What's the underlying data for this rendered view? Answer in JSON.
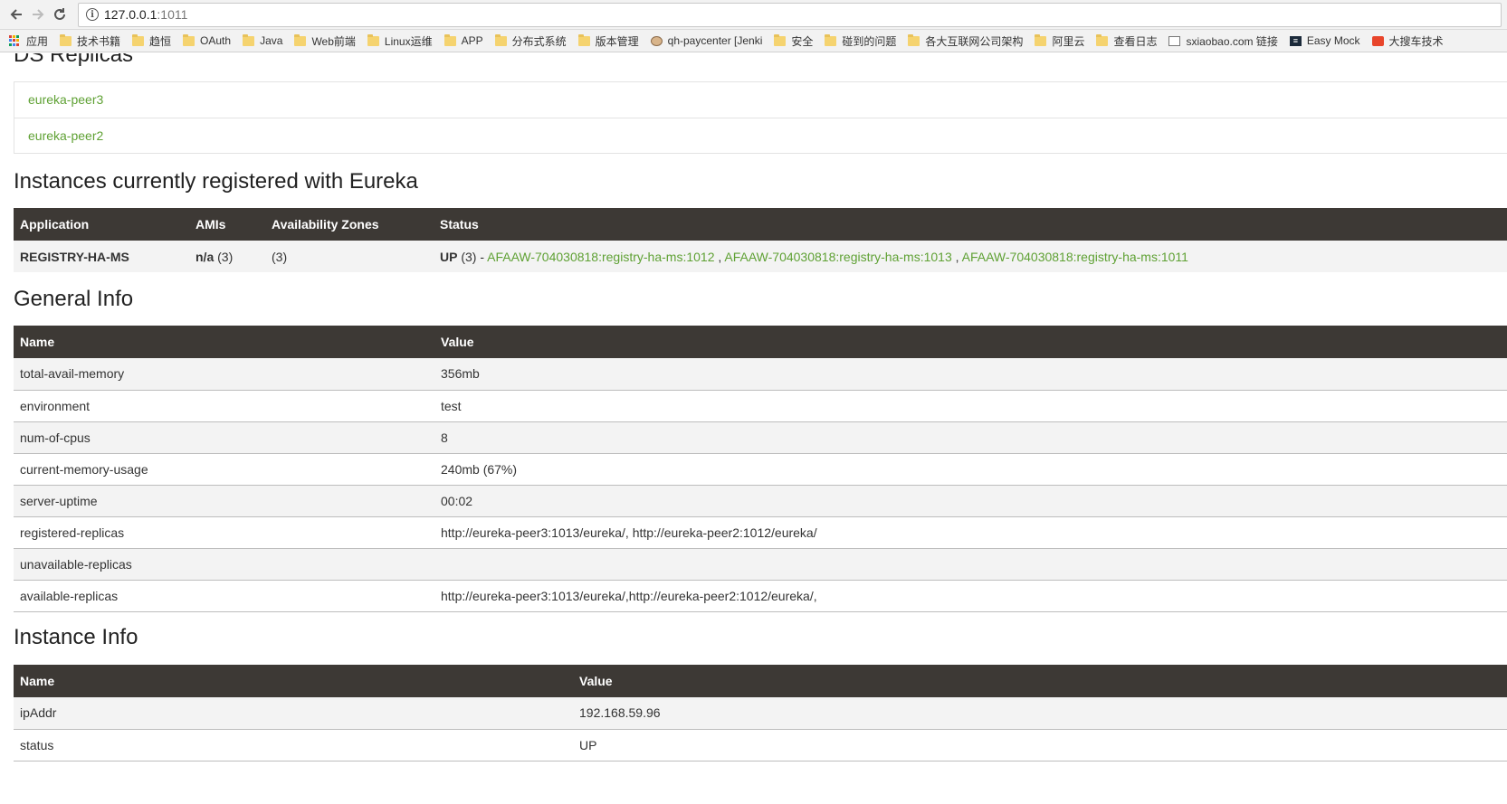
{
  "browser": {
    "url_host": "127.0.0.1",
    "url_port": ":1011",
    "bookmarks": [
      {
        "label": "应用",
        "icon": "apps-grid-icon"
      },
      {
        "label": "技术书籍",
        "icon": "folder-icon"
      },
      {
        "label": "趋恒",
        "icon": "folder-icon"
      },
      {
        "label": "OAuth",
        "icon": "folder-icon"
      },
      {
        "label": "Java",
        "icon": "folder-icon"
      },
      {
        "label": "Web前端",
        "icon": "folder-icon"
      },
      {
        "label": "Linux运维",
        "icon": "folder-icon"
      },
      {
        "label": "APP",
        "icon": "folder-icon"
      },
      {
        "label": "分布式系统",
        "icon": "folder-icon"
      },
      {
        "label": "版本管理",
        "icon": "folder-icon"
      },
      {
        "label": "qh-paycenter [Jenki",
        "icon": "avatar-icon"
      },
      {
        "label": "安全",
        "icon": "folder-icon"
      },
      {
        "label": "碰到的问题",
        "icon": "folder-icon"
      },
      {
        "label": "各大互联网公司架构",
        "icon": "folder-icon"
      },
      {
        "label": "阿里云",
        "icon": "folder-icon"
      },
      {
        "label": "查看日志",
        "icon": "folder-icon"
      },
      {
        "label": "sxiaobao.com 链接",
        "icon": "page-icon"
      },
      {
        "label": "Easy Mock",
        "icon": "easymock-icon"
      },
      {
        "label": "大搜车技术",
        "icon": "red-bookmark-icon"
      }
    ]
  },
  "ds_replicas": {
    "title": "DS Replicas",
    "items": [
      "eureka-peer3",
      "eureka-peer2"
    ]
  },
  "instances": {
    "title": "Instances currently registered with Eureka",
    "headers": [
      "Application",
      "AMIs",
      "Availability Zones",
      "Status"
    ],
    "row": {
      "application": "REGISTRY-HA-MS",
      "amis_value": "n/a",
      "amis_count": " (3)",
      "zones": "(3)",
      "status_prefix": "UP",
      "status_count": " (3) - ",
      "links": [
        "AFAAW-704030818:registry-ha-ms:1012",
        "AFAAW-704030818:registry-ha-ms:1013",
        "AFAAW-704030818:registry-ha-ms:1011"
      ],
      "separator": " , "
    }
  },
  "general_info": {
    "title": "General Info",
    "headers": [
      "Name",
      "Value"
    ],
    "rows": [
      [
        "total-avail-memory",
        "356mb"
      ],
      [
        "environment",
        "test"
      ],
      [
        "num-of-cpus",
        "8"
      ],
      [
        "current-memory-usage",
        "240mb (67%)"
      ],
      [
        "server-uptime",
        "00:02"
      ],
      [
        "registered-replicas",
        "http://eureka-peer3:1013/eureka/, http://eureka-peer2:1012/eureka/"
      ],
      [
        "unavailable-replicas",
        ""
      ],
      [
        "available-replicas",
        "http://eureka-peer3:1013/eureka/,http://eureka-peer2:1012/eureka/,"
      ]
    ]
  },
  "instance_info": {
    "title": "Instance Info",
    "headers": [
      "Name",
      "Value"
    ],
    "rows": [
      [
        "ipAddr",
        "192.168.59.96"
      ],
      [
        "status",
        "UP"
      ]
    ]
  }
}
